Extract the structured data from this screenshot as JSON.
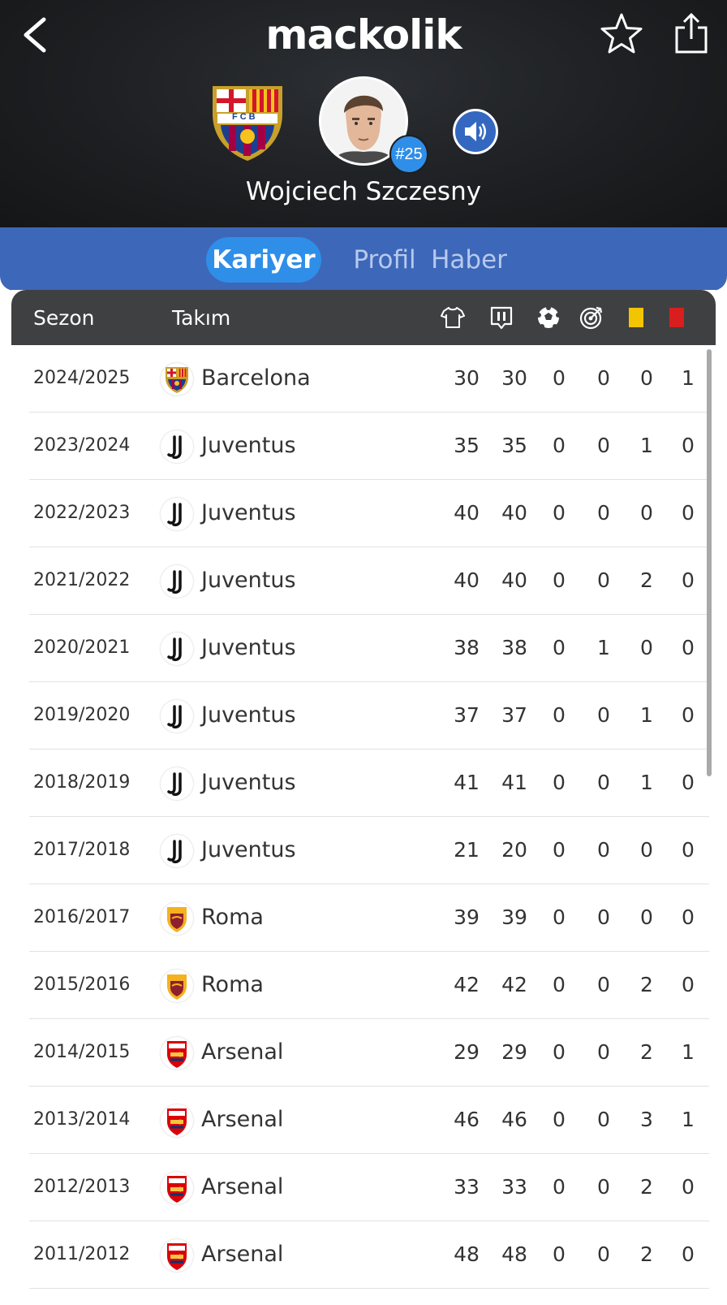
{
  "app": {
    "logo_text": "mackolik"
  },
  "player": {
    "name": "Wojciech Szczesny",
    "shirt_number": "#25",
    "club_crest_text": "FCB"
  },
  "tabs": [
    {
      "label": "Kariyer",
      "active": true
    },
    {
      "label": "Profil",
      "active": false
    },
    {
      "label": "Haber",
      "active": false
    }
  ],
  "table": {
    "headers": {
      "season": "Sezon",
      "team": "Takım"
    },
    "stat_icons": [
      "jersey-icon",
      "starting-eleven-icon",
      "ball-icon",
      "target-icon",
      "yellow-card-icon",
      "red-card-icon"
    ],
    "rows": [
      {
        "season": "2024/2025",
        "team": "Barcelona",
        "logo": "barcelona",
        "stats": [
          "30",
          "30",
          "0",
          "0",
          "0",
          "1"
        ]
      },
      {
        "season": "2023/2024",
        "team": "Juventus",
        "logo": "juventus",
        "stats": [
          "35",
          "35",
          "0",
          "0",
          "1",
          "0"
        ]
      },
      {
        "season": "2022/2023",
        "team": "Juventus",
        "logo": "juventus",
        "stats": [
          "40",
          "40",
          "0",
          "0",
          "0",
          "0"
        ]
      },
      {
        "season": "2021/2022",
        "team": "Juventus",
        "logo": "juventus",
        "stats": [
          "40",
          "40",
          "0",
          "0",
          "2",
          "0"
        ]
      },
      {
        "season": "2020/2021",
        "team": "Juventus",
        "logo": "juventus",
        "stats": [
          "38",
          "38",
          "0",
          "1",
          "0",
          "0"
        ]
      },
      {
        "season": "2019/2020",
        "team": "Juventus",
        "logo": "juventus",
        "stats": [
          "37",
          "37",
          "0",
          "0",
          "1",
          "0"
        ]
      },
      {
        "season": "2018/2019",
        "team": "Juventus",
        "logo": "juventus",
        "stats": [
          "41",
          "41",
          "0",
          "0",
          "1",
          "0"
        ]
      },
      {
        "season": "2017/2018",
        "team": "Juventus",
        "logo": "juventus",
        "stats": [
          "21",
          "20",
          "0",
          "0",
          "0",
          "0"
        ]
      },
      {
        "season": "2016/2017",
        "team": "Roma",
        "logo": "roma",
        "stats": [
          "39",
          "39",
          "0",
          "0",
          "0",
          "0"
        ]
      },
      {
        "season": "2015/2016",
        "team": "Roma",
        "logo": "roma",
        "stats": [
          "42",
          "42",
          "0",
          "0",
          "2",
          "0"
        ]
      },
      {
        "season": "2014/2015",
        "team": "Arsenal",
        "logo": "arsenal",
        "stats": [
          "29",
          "29",
          "0",
          "0",
          "2",
          "1"
        ]
      },
      {
        "season": "2013/2014",
        "team": "Arsenal",
        "logo": "arsenal",
        "stats": [
          "46",
          "46",
          "0",
          "0",
          "3",
          "1"
        ]
      },
      {
        "season": "2012/2013",
        "team": "Arsenal",
        "logo": "arsenal",
        "stats": [
          "33",
          "33",
          "0",
          "0",
          "2",
          "0"
        ]
      },
      {
        "season": "2011/2012",
        "team": "Arsenal",
        "logo": "arsenal",
        "stats": [
          "48",
          "48",
          "0",
          "0",
          "2",
          "0"
        ]
      }
    ]
  },
  "colors": {
    "header_bg": "#1d1f22",
    "tab_bar": "#3d67b8",
    "tab_active": "#2f8ee8",
    "table_header": "#3f4042",
    "yellow_card": "#f2c500",
    "red_card": "#d81e1e"
  }
}
